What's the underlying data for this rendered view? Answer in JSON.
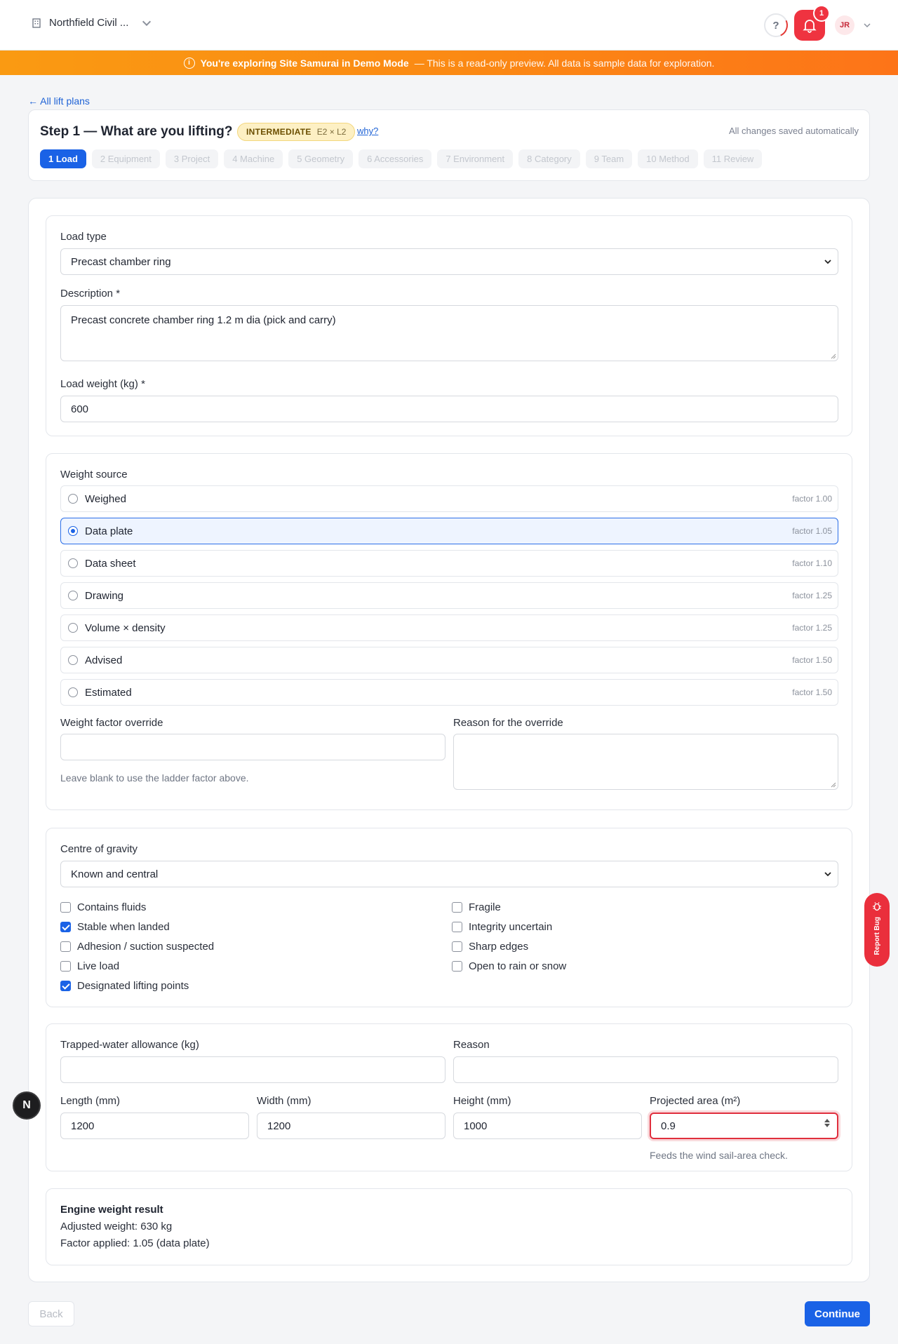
{
  "header": {
    "org_name": "Northfield Civil ...",
    "notification_count": "1",
    "user_initials": "JR"
  },
  "banner": {
    "title": "You're exploring Site Samurai in Demo Mode",
    "subtitle": "— This is a read-only preview. All data is sample data for exploration."
  },
  "nav": {
    "back_link": "← All lift plans"
  },
  "step": {
    "title": "Step 1 — What are you lifting?",
    "level": "INTERMEDIATE",
    "level_code": "E2 × L2",
    "why": "why?",
    "autosave": "All changes saved automatically",
    "pills": [
      "1 Load",
      "2 Equipment",
      "3 Project",
      "4 Machine",
      "5 Geometry",
      "6 Accessories",
      "7 Environment",
      "8 Category",
      "9 Team",
      "10 Method",
      "11 Review"
    ]
  },
  "load": {
    "type_label": "Load type",
    "type_value": "Precast chamber ring",
    "description_label": "Description *",
    "description_value": "Precast concrete chamber ring 1.2 m dia (pick and carry)",
    "weight_label": "Load weight (kg) *",
    "weight_value": "600"
  },
  "weight_source": {
    "label": "Weight source",
    "options": [
      {
        "label": "Weighed",
        "factor": "factor 1.00",
        "selected": false
      },
      {
        "label": "Data plate",
        "factor": "factor 1.05",
        "selected": true
      },
      {
        "label": "Data sheet",
        "factor": "factor 1.10",
        "selected": false
      },
      {
        "label": "Drawing",
        "factor": "factor 1.25",
        "selected": false
      },
      {
        "label": "Volume × density",
        "factor": "factor 1.25",
        "selected": false
      },
      {
        "label": "Advised",
        "factor": "factor 1.50",
        "selected": false
      },
      {
        "label": "Estimated",
        "factor": "factor 1.50",
        "selected": false
      }
    ],
    "override_label": "Weight factor override",
    "override_value": "",
    "override_hint": "Leave blank to use the ladder factor above.",
    "reason_label": "Reason for the override",
    "reason_value": ""
  },
  "cog": {
    "label": "Centre of gravity",
    "value": "Known and central",
    "checks_left": [
      {
        "label": "Contains fluids",
        "checked": false
      },
      {
        "label": "Stable when landed",
        "checked": true
      },
      {
        "label": "Adhesion / suction suspected",
        "checked": false
      },
      {
        "label": "Live load",
        "checked": false
      },
      {
        "label": "Designated lifting points",
        "checked": true
      }
    ],
    "checks_right": [
      {
        "label": "Fragile",
        "checked": false
      },
      {
        "label": "Integrity uncertain",
        "checked": false
      },
      {
        "label": "Sharp edges",
        "checked": false
      },
      {
        "label": "Open to rain or snow",
        "checked": false
      }
    ]
  },
  "dims": {
    "trapped_label": "Trapped-water allowance (kg)",
    "trapped_value": "",
    "reason_label": "Reason",
    "reason_value": "",
    "length_label": "Length (mm)",
    "length_value": "1200",
    "width_label": "Width (mm)",
    "width_value": "1200",
    "height_label": "Height (mm)",
    "height_value": "1000",
    "area_label": "Projected area (m²)",
    "area_value": "0.9",
    "area_hint": "Feeds the wind sail-area check."
  },
  "result": {
    "title": "Engine weight result",
    "adjusted": "Adjusted weight: 630 kg",
    "factor": "Factor applied: 1.05 (data plate)"
  },
  "footer": {
    "back": "Back",
    "continue": "Continue"
  },
  "widgets": {
    "report_bug": "Report Bug",
    "n_badge": "N"
  }
}
